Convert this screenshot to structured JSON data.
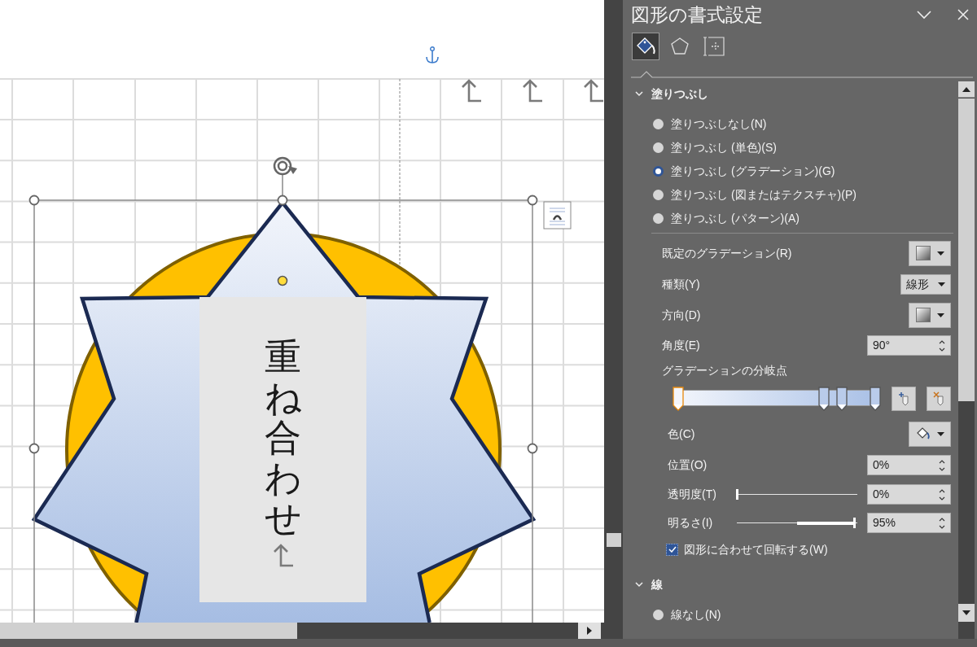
{
  "document": {
    "text_box": {
      "text": "重ね合わせ"
    }
  },
  "panel": {
    "title": "図形の書式設定",
    "tabs": [
      {
        "kind": "fill",
        "selected": true
      },
      {
        "kind": "effects",
        "selected": false
      },
      {
        "kind": "size",
        "selected": false
      }
    ],
    "sections": [
      {
        "title": "塗りつぶし",
        "expanded": true,
        "options": [
          {
            "label": "塗りつぶしなし(N)",
            "selected": false
          },
          {
            "label": "塗りつぶし (単色)(S)",
            "selected": false
          },
          {
            "label": "塗りつぶし (グラデーション)(G)",
            "selected": true
          },
          {
            "label": "塗りつぶし (図またはテクスチャ)(P)",
            "selected": false
          },
          {
            "label": "塗りつぶし (パターン)(A)",
            "selected": false
          }
        ],
        "rows": [
          {
            "kind": "swatch",
            "label": "既定のグラデーション(R)"
          },
          {
            "kind": "dropdown",
            "label": "種類(Y)",
            "value": "線形"
          },
          {
            "kind": "swatch",
            "label": "方向(D)"
          },
          {
            "kind": "spin",
            "label": "角度(E)",
            "value": "90°"
          },
          {
            "kind": "heading",
            "label": "グラデーションの分岐点"
          },
          {
            "kind": "stops",
            "stops": [
              {
                "level": 0,
                "selected": true
              },
              {
                "level": 0.74,
                "selected": false
              },
              {
                "level": 0.83,
                "selected": false
              },
              {
                "level": 1,
                "selected": false
              }
            ]
          },
          {
            "kind": "color",
            "label": "色(C)"
          },
          {
            "kind": "spin",
            "label": "位置(O)",
            "value": "0%"
          },
          {
            "kind": "slider",
            "label": "透明度(T)",
            "level": 0,
            "value": "0%"
          },
          {
            "kind": "slider",
            "label": "明るさ(I)",
            "level": 0.975,
            "value": "95%"
          },
          {
            "kind": "checkbox",
            "label": "図形に合わせて回転する(W)",
            "checked": true
          }
        ]
      },
      {
        "title": "線",
        "expanded": true,
        "options": [
          {
            "label": "線なし(N)",
            "selected": false
          }
        ]
      }
    ]
  }
}
